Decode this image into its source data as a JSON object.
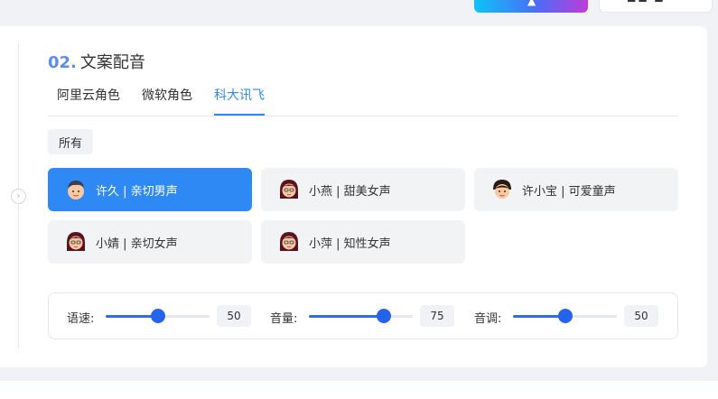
{
  "section": {
    "number": "02.",
    "title": "文案配音"
  },
  "tabs": [
    {
      "label": "阿里云角色",
      "active": false
    },
    {
      "label": "微软角色",
      "active": false
    },
    {
      "label": "科大讯飞",
      "active": true
    }
  ],
  "filter": {
    "label": "所有"
  },
  "voices": [
    {
      "label": "许久 | 亲切男声",
      "avatar": "male-avatar-icon",
      "selected": true
    },
    {
      "label": "小燕 | 甜美女声",
      "avatar": "female-avatar-icon",
      "selected": false
    },
    {
      "label": "许小宝 | 可爱童声",
      "avatar": "child-avatar-icon",
      "selected": false
    },
    {
      "label": "小婧 | 亲切女声",
      "avatar": "female-avatar-icon",
      "selected": false
    },
    {
      "label": "小萍 | 知性女声",
      "avatar": "female-avatar-icon",
      "selected": false
    }
  ],
  "sliders": [
    {
      "label": "语速:",
      "value": "50",
      "level": 0.5
    },
    {
      "label": "音量:",
      "value": "75",
      "level": 0.72
    },
    {
      "label": "音调:",
      "value": "50",
      "level": 0.5
    }
  ],
  "colors": {
    "accent": "#2e89f5",
    "section_number": "#5b8def",
    "slider": "#2563eb"
  }
}
